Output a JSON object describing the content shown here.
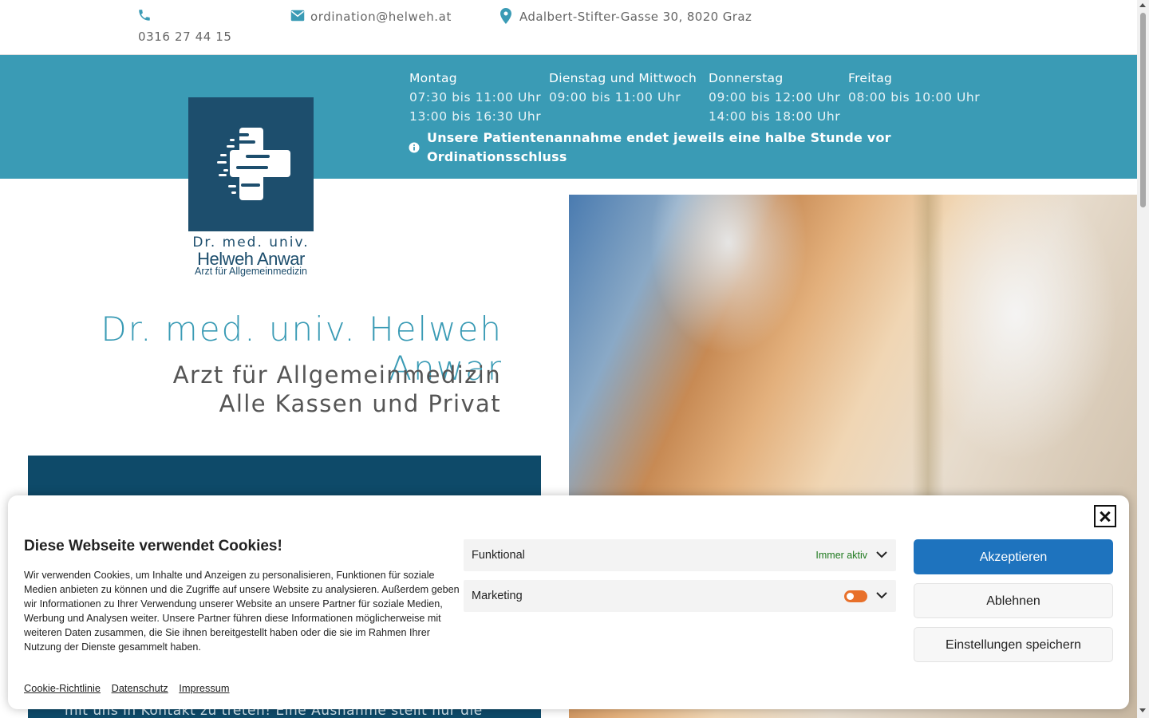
{
  "topbar": {
    "phone": "0316 27 44 15",
    "email": "ordination@helweh.at",
    "address": "Adalbert-Stifter-Gasse 30, 8020 Graz"
  },
  "hours": {
    "days": [
      {
        "name": "Montag",
        "times": [
          "07:30 bis 11:00 Uhr",
          "13:00 bis 16:30 Uhr"
        ]
      },
      {
        "name": "Dienstag und Mittwoch",
        "times": [
          "09:00 bis 11:00 Uhr"
        ]
      },
      {
        "name": "Donnerstag",
        "times": [
          "09:00 bis 12:00 Uhr",
          "14:00 bis 18:00 Uhr"
        ]
      },
      {
        "name": "Freitag",
        "times": [
          "08:00 bis 10:00 Uhr"
        ]
      }
    ],
    "notice": "Unsere Patientenannahme endet jeweils eine halbe Stunde vor Ordinationsschluss"
  },
  "logo": {
    "line1": "Dr. med. univ.",
    "line2": "Helweh Anwar",
    "line3": "Arzt für Allgemeinmedizin"
  },
  "hero": {
    "title": "Dr. med. univ. Helweh Anwar",
    "subtitle_line1": "Arzt für Allgemeinmedizin",
    "subtitle_line2": "Alle Kassen und Privat"
  },
  "darkbox": {
    "text": "mit uns in Kontakt zu treten! Eine Ausnahme stellt nur die"
  },
  "cookie": {
    "title": "Diese Webseite verwendet Cookies!",
    "text": "Wir verwenden Cookies, um Inhalte und Anzeigen zu personalisieren, Funktionen für soziale Medien anbieten zu können und die Zugriffe auf unsere Website zu analysieren. Außerdem geben wir Informationen zu Ihrer Verwendung unserer Website an unsere Partner für soziale Medien, Werbung und Analysen weiter. Unsere Partner führen diese Informationen möglicherweise mit weiteren Daten zusammen, die Sie ihnen bereitgestellt haben oder die sie im Rahmen Ihrer Nutzung der Dienste gesammelt haben.",
    "links": [
      "Cookie-Richtlinie",
      "Datenschutz",
      "Impressum"
    ],
    "categories": [
      {
        "label": "Funktional",
        "status": "Immer aktiv"
      },
      {
        "label": "Marketing",
        "toggle": "off"
      }
    ],
    "buttons": {
      "accept": "Akzeptieren",
      "deny": "Ablehnen",
      "save": "Einstellungen speichern"
    }
  },
  "colors": {
    "accent": "#3a9bb5",
    "logo_blue": "#1d4e6d",
    "dark_box": "#0e4a69",
    "accept_button": "#1e73be",
    "toggle": "#e8702a"
  }
}
